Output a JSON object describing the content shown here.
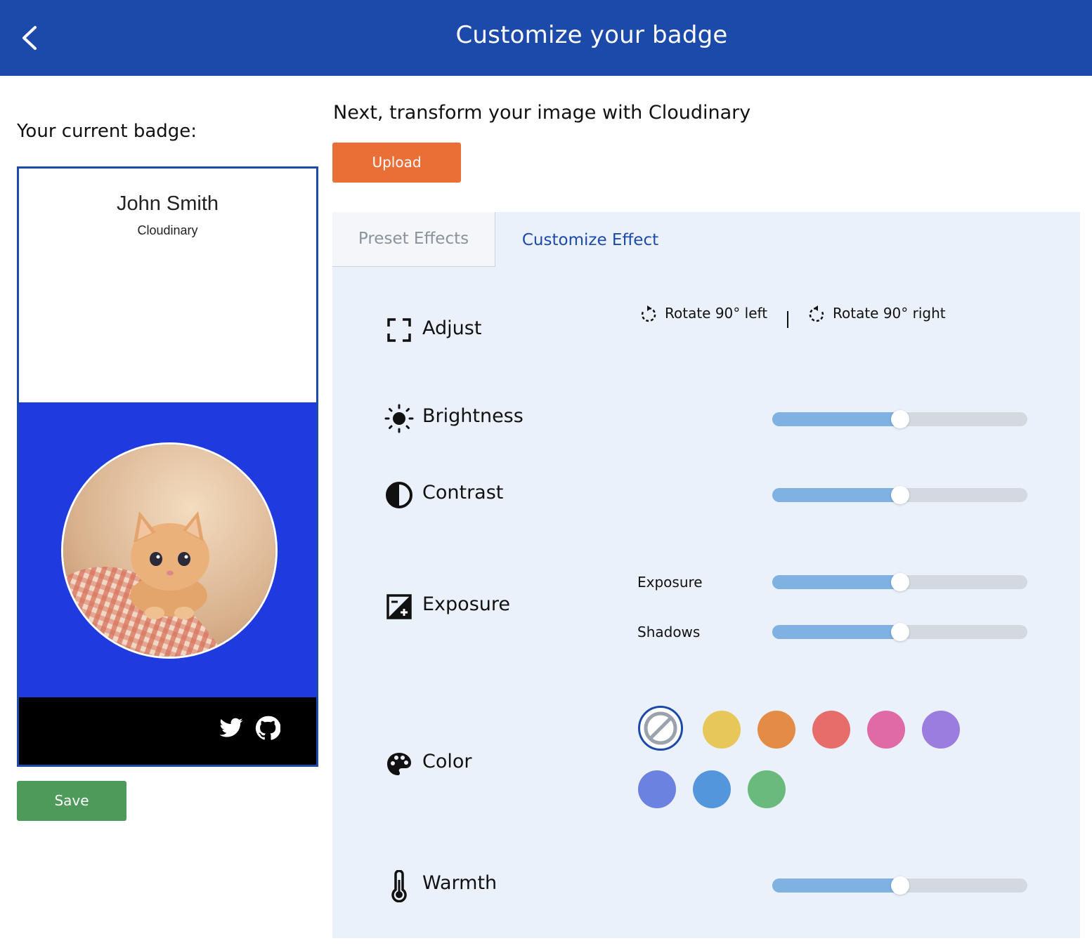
{
  "header": {
    "title": "Customize your badge",
    "back_icon": "chevron-left-icon"
  },
  "left": {
    "current_label": "Your current badge:",
    "badge": {
      "name": "John Smith",
      "organization": "Cloudinary",
      "footer_icons": [
        "twitter-icon",
        "github-icon"
      ],
      "colors": {
        "border": "#1c4aab",
        "photo_background": "#1f3be0",
        "footer": "#000000"
      }
    },
    "save_label": "Save"
  },
  "right": {
    "intro": "Next, transform your image with Cloudinary",
    "upload_label": "Upload",
    "tabs": [
      {
        "label": "Preset Effects",
        "active": false
      },
      {
        "label": "Customize Effect",
        "active": true
      }
    ],
    "adjust": {
      "label": "Adjust",
      "rotate_left": "Rotate 90° left",
      "rotate_right": "Rotate 90° right"
    },
    "brightness": {
      "label": "Brightness",
      "value": 0.5
    },
    "contrast": {
      "label": "Contrast",
      "value": 0.5
    },
    "exposure": {
      "label": "Exposure",
      "sub": [
        {
          "label": "Exposure",
          "value": 0.5
        },
        {
          "label": "Shadows",
          "value": 0.5
        }
      ]
    },
    "color": {
      "label": "Color",
      "swatches": [
        "none",
        "#e8c75a",
        "#e38c45",
        "#e66d6a",
        "#df6aa5",
        "#9b7de0",
        "#6c82e0",
        "#5496db",
        "#6aba7e"
      ],
      "selected": "none"
    },
    "warmth": {
      "label": "Warmth",
      "value": 0.5
    }
  },
  "colors": {
    "accent": "#1c4aab",
    "upload": "#ea6f37",
    "save": "#4d9a5b",
    "panel": "#ebf1fb",
    "slider_fill": "#7fb1e3",
    "slider_track": "#d4d9e0"
  }
}
